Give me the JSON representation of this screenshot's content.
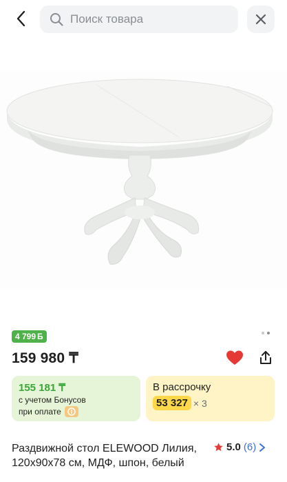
{
  "search": {
    "placeholder": "Поиск товара"
  },
  "product": {
    "bonus_badge": "4 799",
    "bonus_badge_currency": "Б",
    "price": "159 980 ₸",
    "bonus_offer": {
      "price": "155 181 ₸",
      "note_line1": "с учетом Бонусов",
      "note_line2": "при оплате"
    },
    "installment": {
      "title": "В рассрочку",
      "amount": "53 327",
      "multiplier": "× 3"
    },
    "title": "Раздвижной стол ELEWOOD Лилия, 120x90x78 см, МДФ, шпон, белый",
    "rating": {
      "value": "5.0",
      "count": "(6)"
    },
    "gallery": {
      "slide_count": 2,
      "active_index": 1
    }
  },
  "icons": {
    "back": "chevron-left-icon",
    "search": "search-icon",
    "close": "close-icon",
    "favorite": "heart-icon",
    "share": "share-icon",
    "star": "star-icon",
    "rating_arrow": "chevron-right-icon",
    "bonus_coin": "bonus-coin-icon"
  },
  "colors": {
    "accent_green": "#3aa637",
    "badge_green": "#4fb14a",
    "installment_yellow": "#ffd74a",
    "heart_red": "#e53935",
    "link_blue": "#3b6fd8",
    "star_red": "#e53935"
  }
}
